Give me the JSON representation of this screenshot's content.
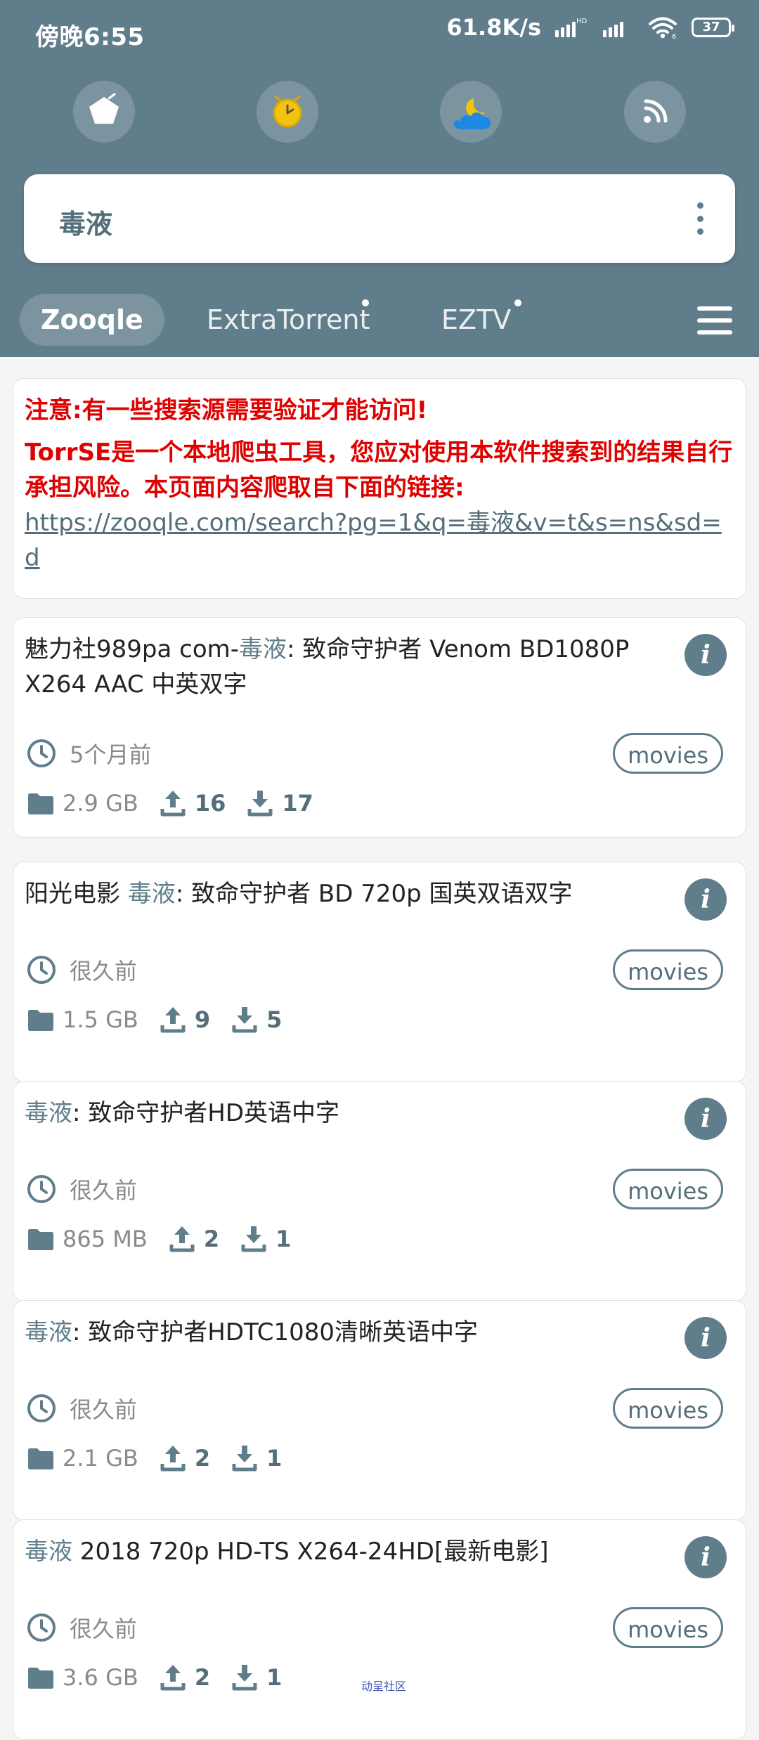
{
  "status_bar": {
    "time": "傍晚6:55",
    "network_speed": "61.8K/s",
    "battery_level": "37"
  },
  "top_actions": [
    {
      "icon": "pentagon-icon"
    },
    {
      "icon": "clock-icon"
    },
    {
      "icon": "moon-cloud-icon"
    },
    {
      "icon": "rss-icon"
    }
  ],
  "search": {
    "query": "毒液"
  },
  "tabs": [
    {
      "label": "Zooqle",
      "active": true
    },
    {
      "label": "ExtraTorrent",
      "active": false,
      "dot": true
    },
    {
      "label": "EZTV",
      "active": false,
      "dot": true
    }
  ],
  "notice": {
    "title": "注意:有一些搜索源需要验证才能访问!",
    "body": "TorrSE是一个本地爬虫工具，您应对使用本软件搜索到的结果自行承担风险。本页面内容爬取自下面的链接:",
    "link": "https://zooqle.com/search?pg=1&q=毒液&v=t&s=ns&sd=d"
  },
  "results": [
    {
      "title_prefix": "魅力社989pa com-",
      "title_highlight": "毒液",
      "title_suffix": ": 致命守护者 Venom BD1080P X264 AAC 中英双字",
      "time": "5个月前",
      "tag": "movies",
      "size": "2.9 GB",
      "seeders": "16",
      "leechers": "17"
    },
    {
      "title_prefix": "阳光电影 ",
      "title_highlight": "毒液",
      "title_suffix": ": 致命守护者 BD 720p 国英双语双字",
      "time": "很久前",
      "tag": "movies",
      "size": "1.5 GB",
      "seeders": "9",
      "leechers": "5"
    },
    {
      "title_prefix": "",
      "title_highlight": "毒液",
      "title_suffix": ": 致命守护者HD英语中字",
      "time": "很久前",
      "tag": "movies",
      "size": "865 MB",
      "seeders": "2",
      "leechers": "1"
    },
    {
      "title_prefix": "",
      "title_highlight": "毒液",
      "title_suffix": ": 致命守护者HDTC1080清晰英语中字",
      "time": "很久前",
      "tag": "movies",
      "size": "2.1 GB",
      "seeders": "2",
      "leechers": "1"
    },
    {
      "title_prefix": "",
      "title_highlight": "毒液",
      "title_suffix": " 2018 720p HD-TS X264-24HD[最新电影]",
      "time": "很久前",
      "tag": "movies",
      "size": "3.6 GB",
      "seeders": "2",
      "leechers": "1"
    }
  ],
  "watermark": "动呈社区"
}
